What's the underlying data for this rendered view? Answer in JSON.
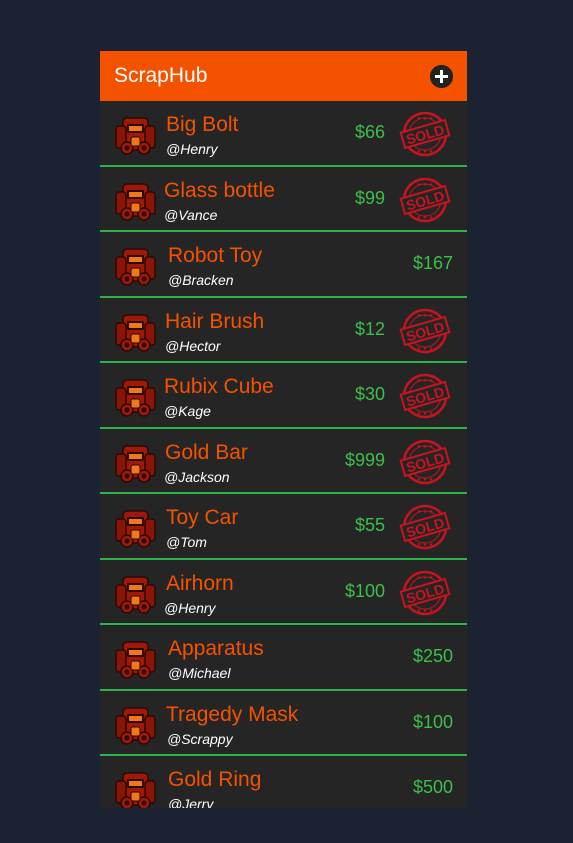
{
  "app": {
    "title": "ScrapHub",
    "add_icon": "plus-circle-icon",
    "accent_color": "#f55200",
    "price_color": "#3cbf4b",
    "divider_color": "#2db34a"
  },
  "sold_label": "SOLD",
  "items": [
    {
      "name": "Big Bolt",
      "seller": "@Henry",
      "price": "$66",
      "sold": true
    },
    {
      "name": "Glass bottle",
      "seller": "@Vance",
      "price": "$99",
      "sold": true
    },
    {
      "name": "Robot Toy",
      "seller": "@Bracken",
      "price": "$167",
      "sold": false
    },
    {
      "name": "Hair Brush",
      "seller": "@Hector",
      "price": "$12",
      "sold": true
    },
    {
      "name": "Rubix Cube",
      "seller": "@Kage",
      "price": "$30",
      "sold": true
    },
    {
      "name": "Gold Bar",
      "seller": "@Jackson",
      "price": "$999",
      "sold": true
    },
    {
      "name": "Toy Car",
      "seller": "@Tom",
      "price": "$55",
      "sold": true
    },
    {
      "name": "Airhorn",
      "seller": "@Henry",
      "price": "$100",
      "sold": true
    },
    {
      "name": "Apparatus",
      "seller": "@Michael",
      "price": "$250",
      "sold": false
    },
    {
      "name": "Tragedy Mask",
      "seller": "@Scrappy",
      "price": "$100",
      "sold": false
    },
    {
      "name": "Gold Ring",
      "seller": "@Jerry",
      "price": "$500",
      "sold": false
    }
  ]
}
